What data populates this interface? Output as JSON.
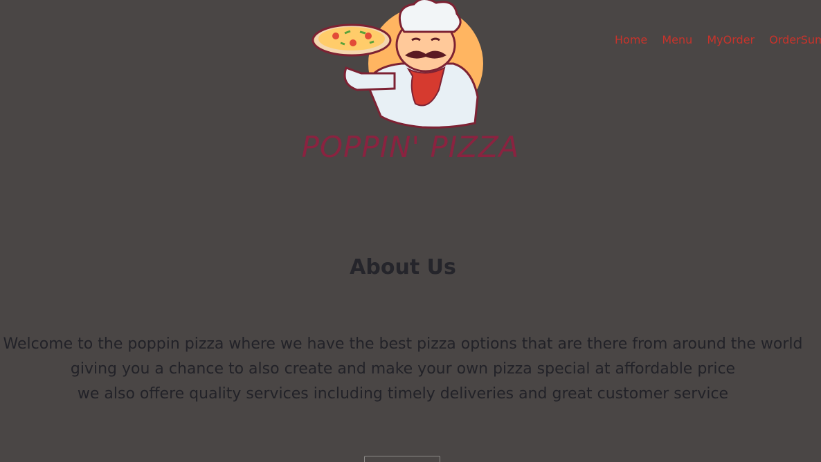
{
  "brand": {
    "name": "POPPIN' PIZZA"
  },
  "nav": {
    "items": [
      {
        "label": "Home"
      },
      {
        "label": "Menu"
      },
      {
        "label": "MyOrder"
      },
      {
        "label": "OrderSumm"
      }
    ]
  },
  "about": {
    "title": "About Us",
    "lines": [
      "Welcome to the poppin pizza where we have the best pizza options that are there from around the world",
      "giving you a chance to also create and make your own pizza special at affordable price",
      "we also offere quality services including timely deliveries and great customer service"
    ]
  },
  "colors": {
    "background": "#4a4645",
    "nav_link": "#c8332b",
    "logo_text": "#8a2340",
    "heading": "#25252b"
  }
}
